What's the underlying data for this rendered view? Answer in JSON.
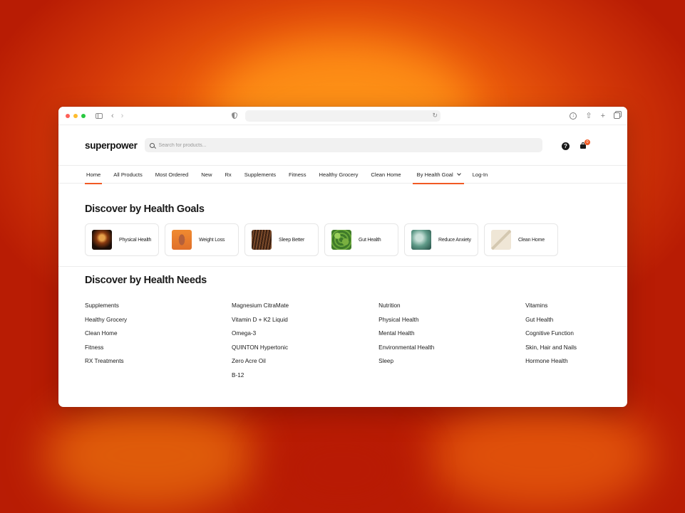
{
  "brand": {
    "logo": "superpower",
    "accent": "#f15a24"
  },
  "browser": {
    "chrome_icons": [
      "sidebar-icon",
      "back-icon",
      "forward-icon",
      "shield-icon",
      "reload-icon",
      "download-icon",
      "share-icon",
      "new-tab-icon",
      "tabs-overview-icon"
    ]
  },
  "header": {
    "search_placeholder": "Search for products...",
    "help_glyph": "?",
    "cart_count": "0"
  },
  "nav": {
    "items": [
      "Home",
      "All Products",
      "Most Ordered",
      "New",
      "Rx",
      "Supplements",
      "Fitness",
      "Healthy Grocery",
      "Clean Home",
      "By Health Goal",
      "Log-In"
    ],
    "active": [
      "Home",
      "By Health Goal"
    ]
  },
  "goals": {
    "title": "Discover by Health Goals",
    "cards": [
      {
        "label": "Physical Health"
      },
      {
        "label": "Weight Loss"
      },
      {
        "label": "Sleep Better"
      },
      {
        "label": "Gut Health"
      },
      {
        "label": "Reduce Anxiety"
      },
      {
        "label": "Clean Home"
      }
    ]
  },
  "needs": {
    "title": "Discover by Health Needs",
    "columns": [
      [
        "Supplements",
        "Healthy Grocery",
        "Clean Home",
        "Fitness",
        "RX Treatments"
      ],
      [
        "Magnesium CitraMate",
        "Vitamin D + K2 Liquid",
        "Omega-3",
        "QUINTON Hypertonic",
        "Zero Acre Oil",
        "B-12"
      ],
      [
        "Nutrition",
        "Physical Health",
        "Mental Health",
        "Environmental Health",
        "Sleep"
      ],
      [
        "Vitamins",
        "Gut Health",
        "Cognitive Function",
        "Skin, Hair and Nails",
        "Hormone Health"
      ]
    ]
  }
}
